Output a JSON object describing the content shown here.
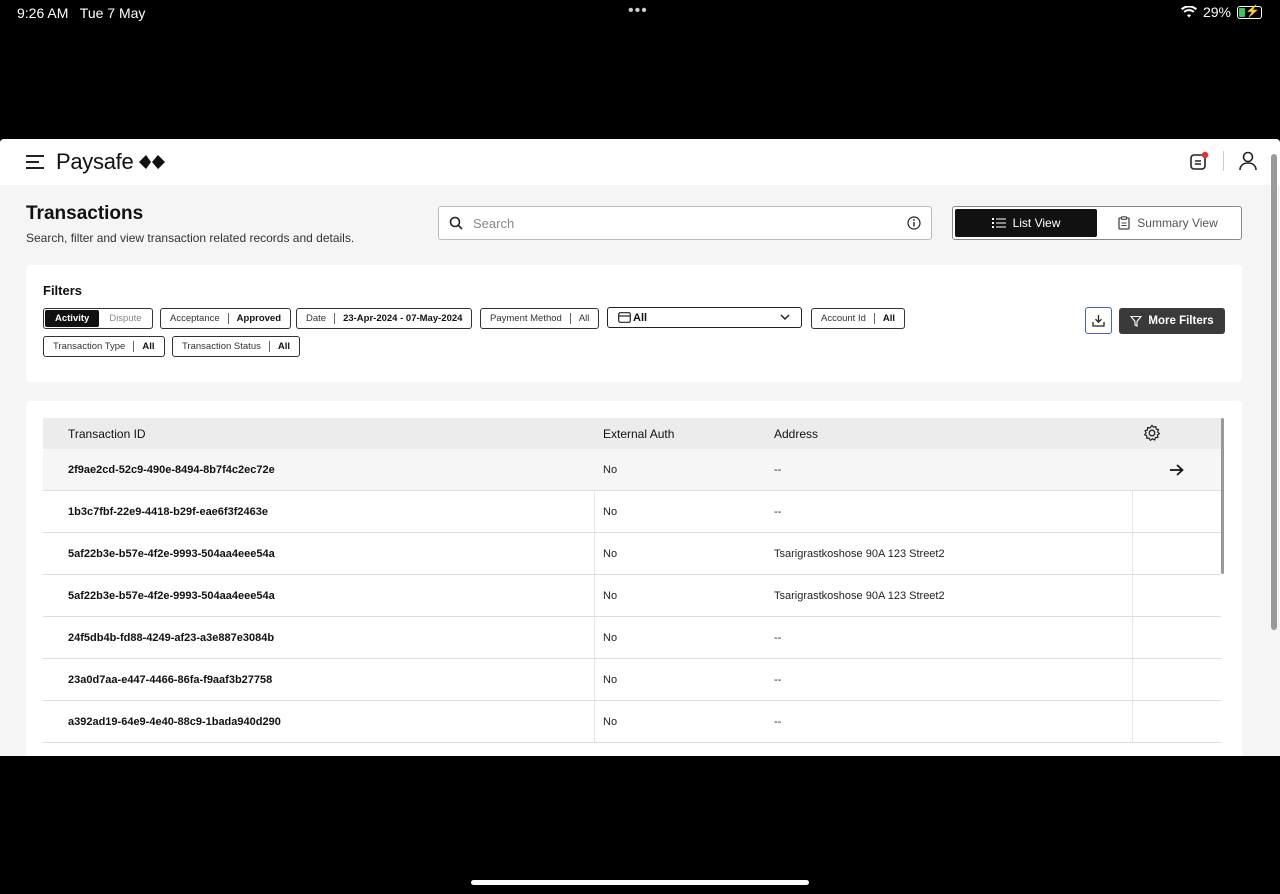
{
  "status": {
    "time": "9:26 AM",
    "date": "Tue 7 May",
    "battery": "29%"
  },
  "brand": {
    "name": "Paysafe"
  },
  "page": {
    "title": "Transactions",
    "subtitle": "Search, filter and view transaction related records and details."
  },
  "search": {
    "placeholder": "Search"
  },
  "views": {
    "list": "List View",
    "summary": "Summary View",
    "active": "list"
  },
  "filters": {
    "title": "Filters",
    "activity": "Activity",
    "dispute": "Dispute",
    "acceptance_label": "Acceptance",
    "acceptance_value": "Approved",
    "date_label": "Date",
    "date_value": "23-Apr-2024 - 07-May-2024",
    "payment_label": "Payment Method",
    "payment_value": "All",
    "dropdown_value": "All",
    "account_label": "Account Id",
    "account_value": "All",
    "type_label": "Transaction Type",
    "type_value": "All",
    "tstatus_label": "Transaction Status",
    "tstatus_value": "All",
    "more_filters": "More Filters"
  },
  "table": {
    "columns": [
      "Transaction ID",
      "External Auth",
      "Address"
    ],
    "rows": [
      {
        "id": "2f9ae2cd-52c9-490e-8494-8b7f4c2ec72e",
        "auth": "No",
        "address": "--"
      },
      {
        "id": "1b3c7fbf-22e9-4418-b29f-eae6f3f2463e",
        "auth": "No",
        "address": "--"
      },
      {
        "id": "5af22b3e-b57e-4f2e-9993-504aa4eee54a",
        "auth": "No",
        "address": "Tsarigrastkoshose 90A 123 Street2"
      },
      {
        "id": "5af22b3e-b57e-4f2e-9993-504aa4eee54a",
        "auth": "No",
        "address": "Tsarigrastkoshose 90A 123 Street2"
      },
      {
        "id": "24f5db4b-fd88-4249-af23-a3e887e3084b",
        "auth": "No",
        "address": "--"
      },
      {
        "id": "23a0d7aa-e447-4466-86fa-f9aaf3b27758",
        "auth": "No",
        "address": "--"
      },
      {
        "id": "a392ad19-64e9-4e40-88c9-1bada940d290",
        "auth": "No",
        "address": "--"
      }
    ]
  }
}
